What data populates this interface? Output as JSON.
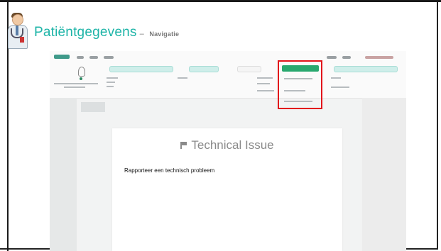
{
  "slide": {
    "title": "Patiëntgegevens",
    "dash": "–",
    "subtitle": "Navigatie"
  },
  "modal": {
    "title": "Technical Issue",
    "body_text": "Rapporteer een technisch probleem"
  },
  "colors": {
    "title": "#1db4a7",
    "highlight": "#e2141b",
    "primary_button": "#29a86f"
  },
  "icons": [
    "doctor-avatar-icon",
    "flag-icon"
  ]
}
